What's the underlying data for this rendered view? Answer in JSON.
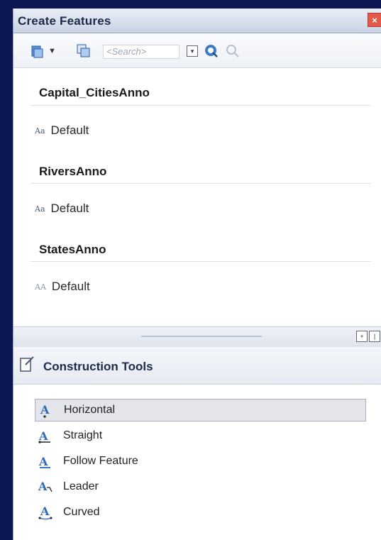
{
  "window": {
    "title": "Create Features",
    "close_glyph": "×"
  },
  "toolbar": {
    "organize_icon": "organize-templates-icon",
    "views_icon": "template-views-icon",
    "search_placeholder": "<Search>",
    "search_go_icon": "search-icon",
    "clear_search_icon": "clear-search-icon"
  },
  "templates": {
    "groups": [
      {
        "name": "Capital_CitiesAnno",
        "items": [
          {
            "label": "Default",
            "icon": "Aa"
          }
        ]
      },
      {
        "name": "RiversAnno",
        "items": [
          {
            "label": "Default",
            "icon": "Aa"
          }
        ]
      },
      {
        "name": "StatesAnno",
        "items": [
          {
            "label": "Default",
            "icon": "AA"
          }
        ]
      }
    ]
  },
  "construction": {
    "title": "Construction Tools",
    "tools": [
      {
        "label": "Horizontal",
        "icon": "horizontal-annotation-icon",
        "selected": true
      },
      {
        "label": "Straight",
        "icon": "straight-annotation-icon",
        "selected": false
      },
      {
        "label": "Follow Feature",
        "icon": "follow-feature-icon",
        "selected": false
      },
      {
        "label": "Leader",
        "icon": "leader-annotation-icon",
        "selected": false
      },
      {
        "label": "Curved",
        "icon": "curved-annotation-icon",
        "selected": false
      }
    ]
  },
  "colors": {
    "background": "#0c1650",
    "accent": "#3b7ac8",
    "close": "#e25a4a"
  }
}
